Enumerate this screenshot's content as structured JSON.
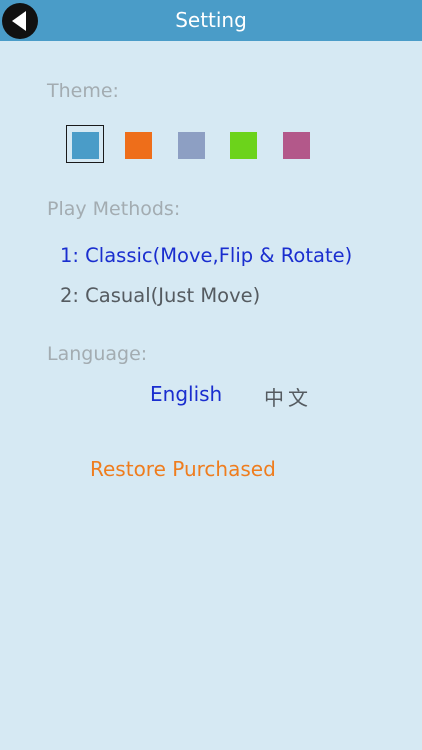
{
  "header": {
    "title": "Setting",
    "back_icon": "back-arrow-icon"
  },
  "theme": {
    "label": "Theme:",
    "selected_index": 0,
    "swatches": [
      {
        "color": "#4a9cc8"
      },
      {
        "color": "#ee6e1a"
      },
      {
        "color": "#8d9fc3"
      },
      {
        "color": "#6cd31b"
      },
      {
        "color": "#b3588a"
      }
    ]
  },
  "play_methods": {
    "label": "Play Methods:",
    "options": [
      {
        "label": "1: Classic(Move,Flip & Rotate)",
        "selected": true
      },
      {
        "label": "2: Casual(Just Move)",
        "selected": false
      }
    ]
  },
  "language": {
    "label": "Language:",
    "options": [
      {
        "label": "English",
        "selected": true
      },
      {
        "label": "中文",
        "selected": false
      }
    ]
  },
  "restore": {
    "label": "Restore Purchased"
  },
  "colors": {
    "header_bg": "#4a9cc8",
    "page_bg": "#d6e9f3",
    "active_text": "#1a2ecf",
    "inactive_text": "#555b60",
    "label_text": "#a3acb1",
    "accent_orange": "#ef7d1e"
  }
}
